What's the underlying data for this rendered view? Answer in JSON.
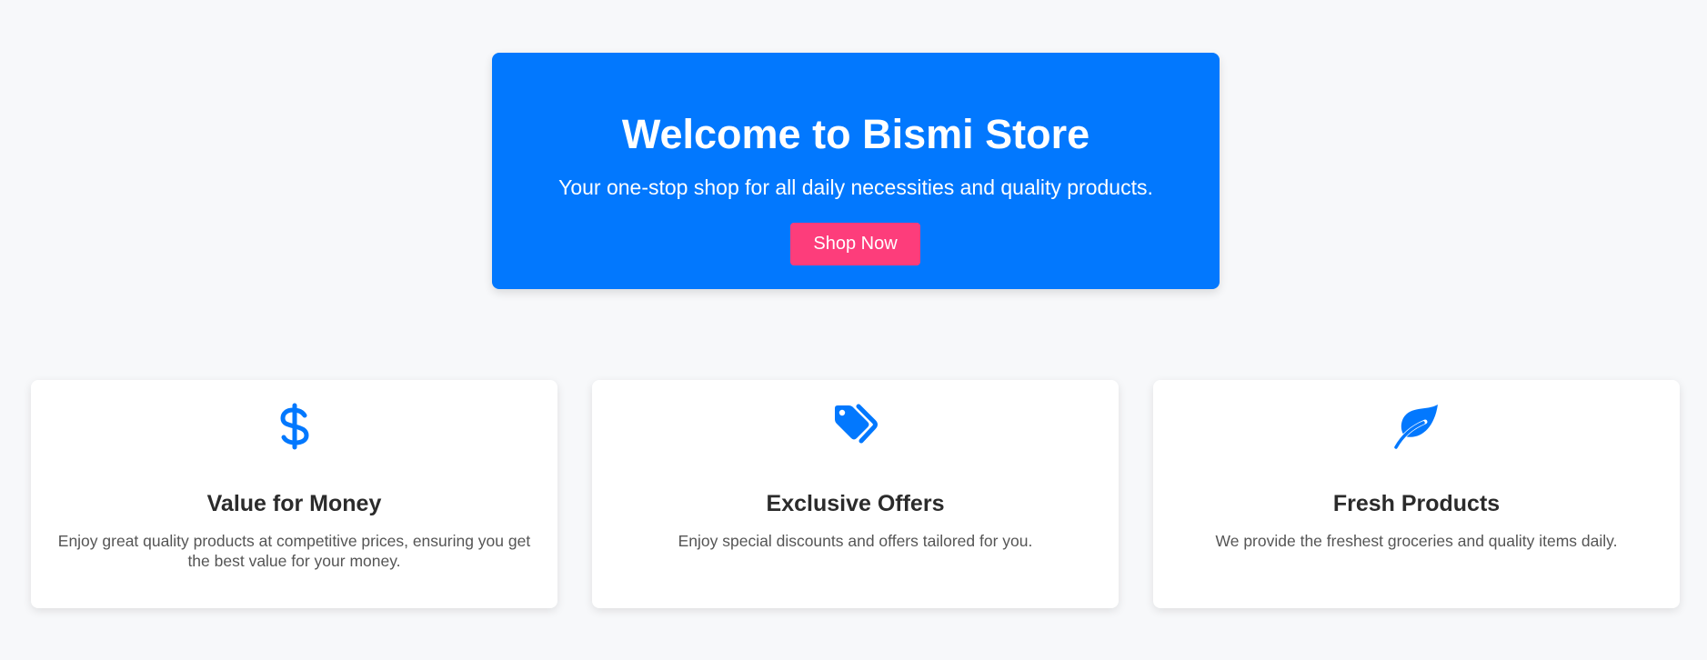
{
  "hero": {
    "title": "Welcome to Bismi Store",
    "subtitle": "Your one-stop shop for all daily necessities and quality products.",
    "button_label": "Shop Now",
    "background_color": "#0278fe",
    "button_color": "#fd3d7b"
  },
  "features": [
    {
      "icon": "dollar-icon",
      "title": "Value for Money",
      "description": "Enjoy great quality products at competitive prices, ensuring you get the best value for your money."
    },
    {
      "icon": "tags-icon",
      "title": "Exclusive Offers",
      "description": "Enjoy special discounts and offers tailored for you."
    },
    {
      "icon": "leaf-icon",
      "title": "Fresh Products",
      "description": "We provide the freshest groceries and quality items daily."
    }
  ],
  "accent_color": "#0278fe"
}
